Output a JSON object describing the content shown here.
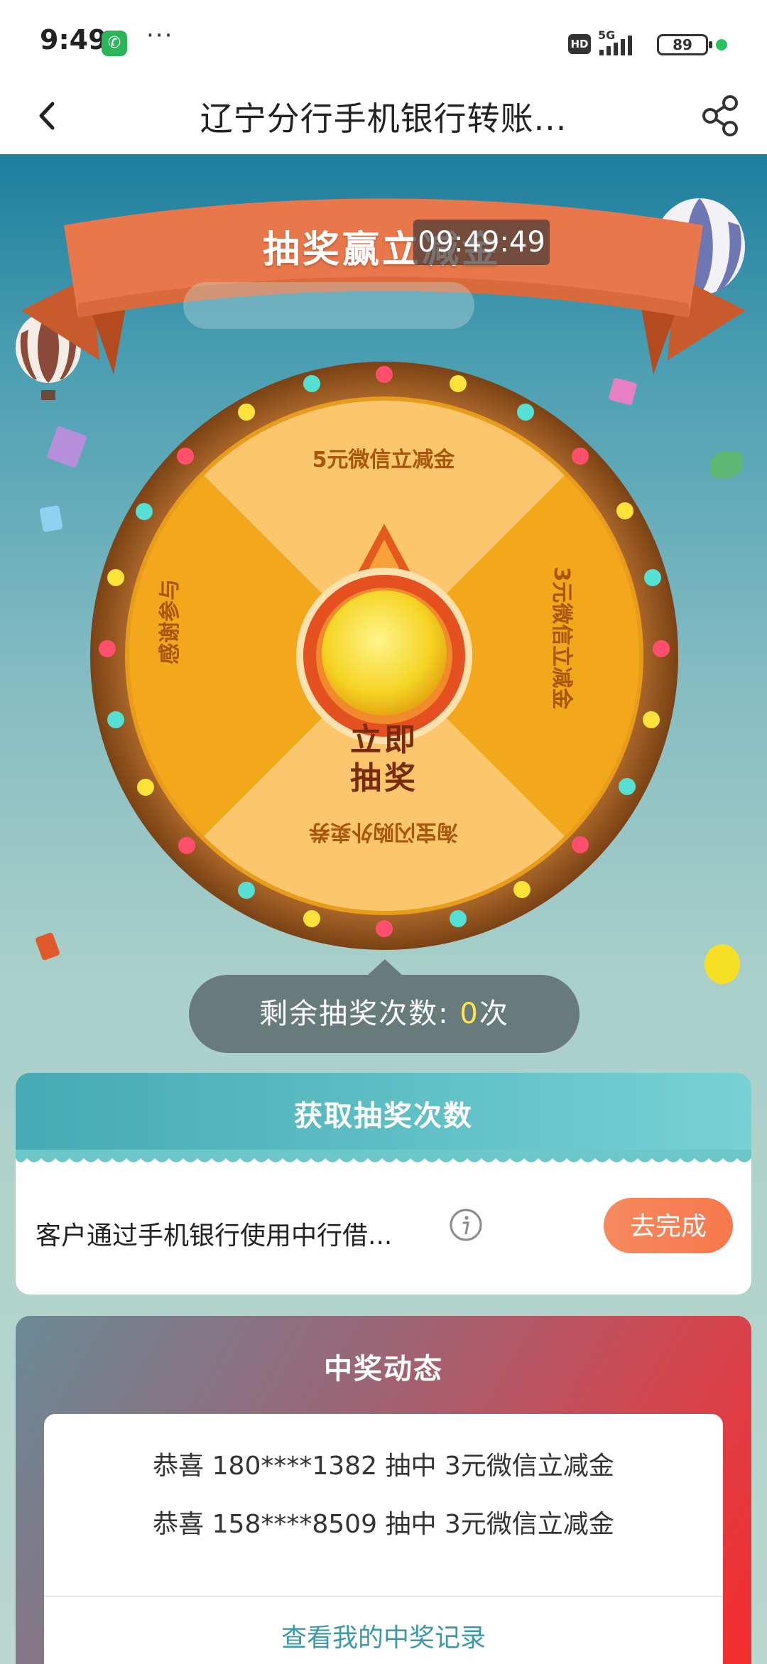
{
  "status_bar": {
    "time": "9:49",
    "call_icon": "phone-icon",
    "more": "···",
    "hd": "HD",
    "network": "5G",
    "battery": "89",
    "dot_color": "#29c260"
  },
  "nav": {
    "title": "辽宁分行手机银行转账...",
    "back_icon": "chevron-left-icon",
    "share_icon": "share-icon"
  },
  "banner": {
    "title": "抽奖赢立减金",
    "time_overlay": "09:49:49"
  },
  "wheel": {
    "prizes": [
      "5元微信立减金",
      "3元微信立减金",
      "淘宝闪购外卖券",
      "感谢参与"
    ],
    "spin_label_line1": "立即",
    "spin_label_line2": "抽奖",
    "colors": {
      "rim": "#9b5b21",
      "light_slice": "#fbc66c",
      "dark_slice": "#f2a81a",
      "button": "#f5d424"
    }
  },
  "remaining": {
    "label": "剩余抽奖次数:",
    "count": "0",
    "unit": "次"
  },
  "get_chances": {
    "title": "获取抽奖次数",
    "task_text": "客户通过手机银行使用中行借...",
    "info_icon": "info-icon",
    "button": "去完成"
  },
  "winners": {
    "title": "中奖动态",
    "items": [
      {
        "prefix": "恭喜",
        "phone": "180****1382",
        "action": "抽中",
        "prize": "3元微信立减金"
      },
      {
        "prefix": "恭喜",
        "phone": "158****8509",
        "action": "抽中",
        "prize": "3元微信立减金"
      }
    ],
    "link": "查看我的中奖记录"
  }
}
